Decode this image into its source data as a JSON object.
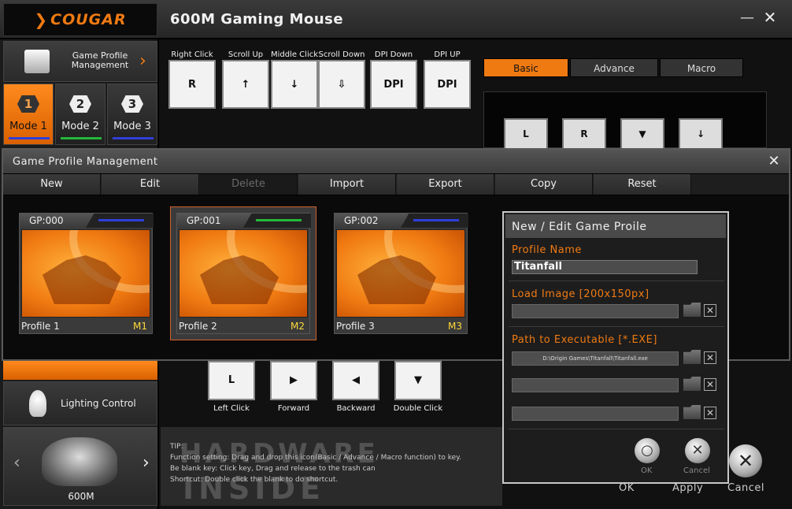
{
  "app": {
    "logo": "COUGAR",
    "title": "600M Gaming Mouse",
    "minimize": "—",
    "close": "✕"
  },
  "sidebar": {
    "gpm_label": "Game Profile Management",
    "modes": [
      {
        "number": "1",
        "label": "Mode 1",
        "active": true,
        "color": "#2f3fd8"
      },
      {
        "number": "2",
        "label": "Mode 2",
        "active": false,
        "color": "#25b83a"
      },
      {
        "number": "3",
        "label": "Mode 3",
        "active": false,
        "color": "#2f3fd8"
      }
    ],
    "lighting_label": "Lighting Control",
    "mouse_label": "600M"
  },
  "functions": [
    {
      "label": "Right Click",
      "glyph": "R"
    },
    {
      "label": "Scroll Up",
      "glyph": "↑"
    },
    {
      "label": "Middle Click",
      "glyph": "↓"
    },
    {
      "label": "Scroll Down",
      "glyph": "⇩"
    },
    {
      "label": "DPI Down",
      "glyph": "DPI"
    },
    {
      "label": "DPI UP",
      "glyph": "DPI"
    }
  ],
  "tabs": {
    "basic": "Basic",
    "advance": "Advance",
    "macro": "Macro"
  },
  "basic_keys": [
    "L",
    "R",
    "▼",
    "↓"
  ],
  "gpm_dialog": {
    "title": "Game Profile Management",
    "close": "✕",
    "toolbar": [
      "New",
      "Edit",
      "Delete",
      "Import",
      "Export",
      "Copy",
      "Reset"
    ],
    "profiles": [
      {
        "gp": "GP:000",
        "name": "Profile 1",
        "mode": "M1",
        "bar_color": "#2f3fd8",
        "selected": false
      },
      {
        "gp": "GP:001",
        "name": "Profile 2",
        "mode": "M2",
        "bar_color": "#25b83a",
        "selected": true
      },
      {
        "gp": "GP:002",
        "name": "Profile 3",
        "mode": "M3",
        "bar_color": "#2f3fd8",
        "selected": false
      }
    ]
  },
  "edit_dialog": {
    "title": "New / Edit Game Proile",
    "profile_name_label": "Profile Name",
    "profile_name_value": "Titanfall",
    "load_image_label": "Load Image [200x150px]",
    "path_label": "Path to Executable [*.EXE]",
    "path_value_1": "D:\\Origin Games\\Titanfall\\Titanfall.exe",
    "path_value_2": "",
    "path_value_3": "",
    "ok_label": "OK",
    "cancel_label": "Cancel"
  },
  "lower_keys": [
    {
      "label": "Left Click",
      "glyph": "L"
    },
    {
      "label": "Forward",
      "glyph": "▶"
    },
    {
      "label": "Backward",
      "glyph": "◀"
    },
    {
      "label": "Double Click",
      "glyph": "▼"
    }
  ],
  "tip": {
    "lines": [
      "TIP:",
      "Function setting: Drag and drop this icon(Basic / Advance / Macro function) to key.",
      "Be blank key: Click key, Drag and release to the trash can",
      "Shortcut: Double click the blank to do shortcut."
    ],
    "watermark_1": "HARDWARE",
    "watermark_2": "INSIDE"
  },
  "bottom_actions": {
    "ok": "OK",
    "apply": "Apply",
    "cancel": "Cancel"
  },
  "colors": {
    "accent": "#f07a12",
    "selected_frame": "#d2612a",
    "mode_tag": "#ffd93b"
  }
}
